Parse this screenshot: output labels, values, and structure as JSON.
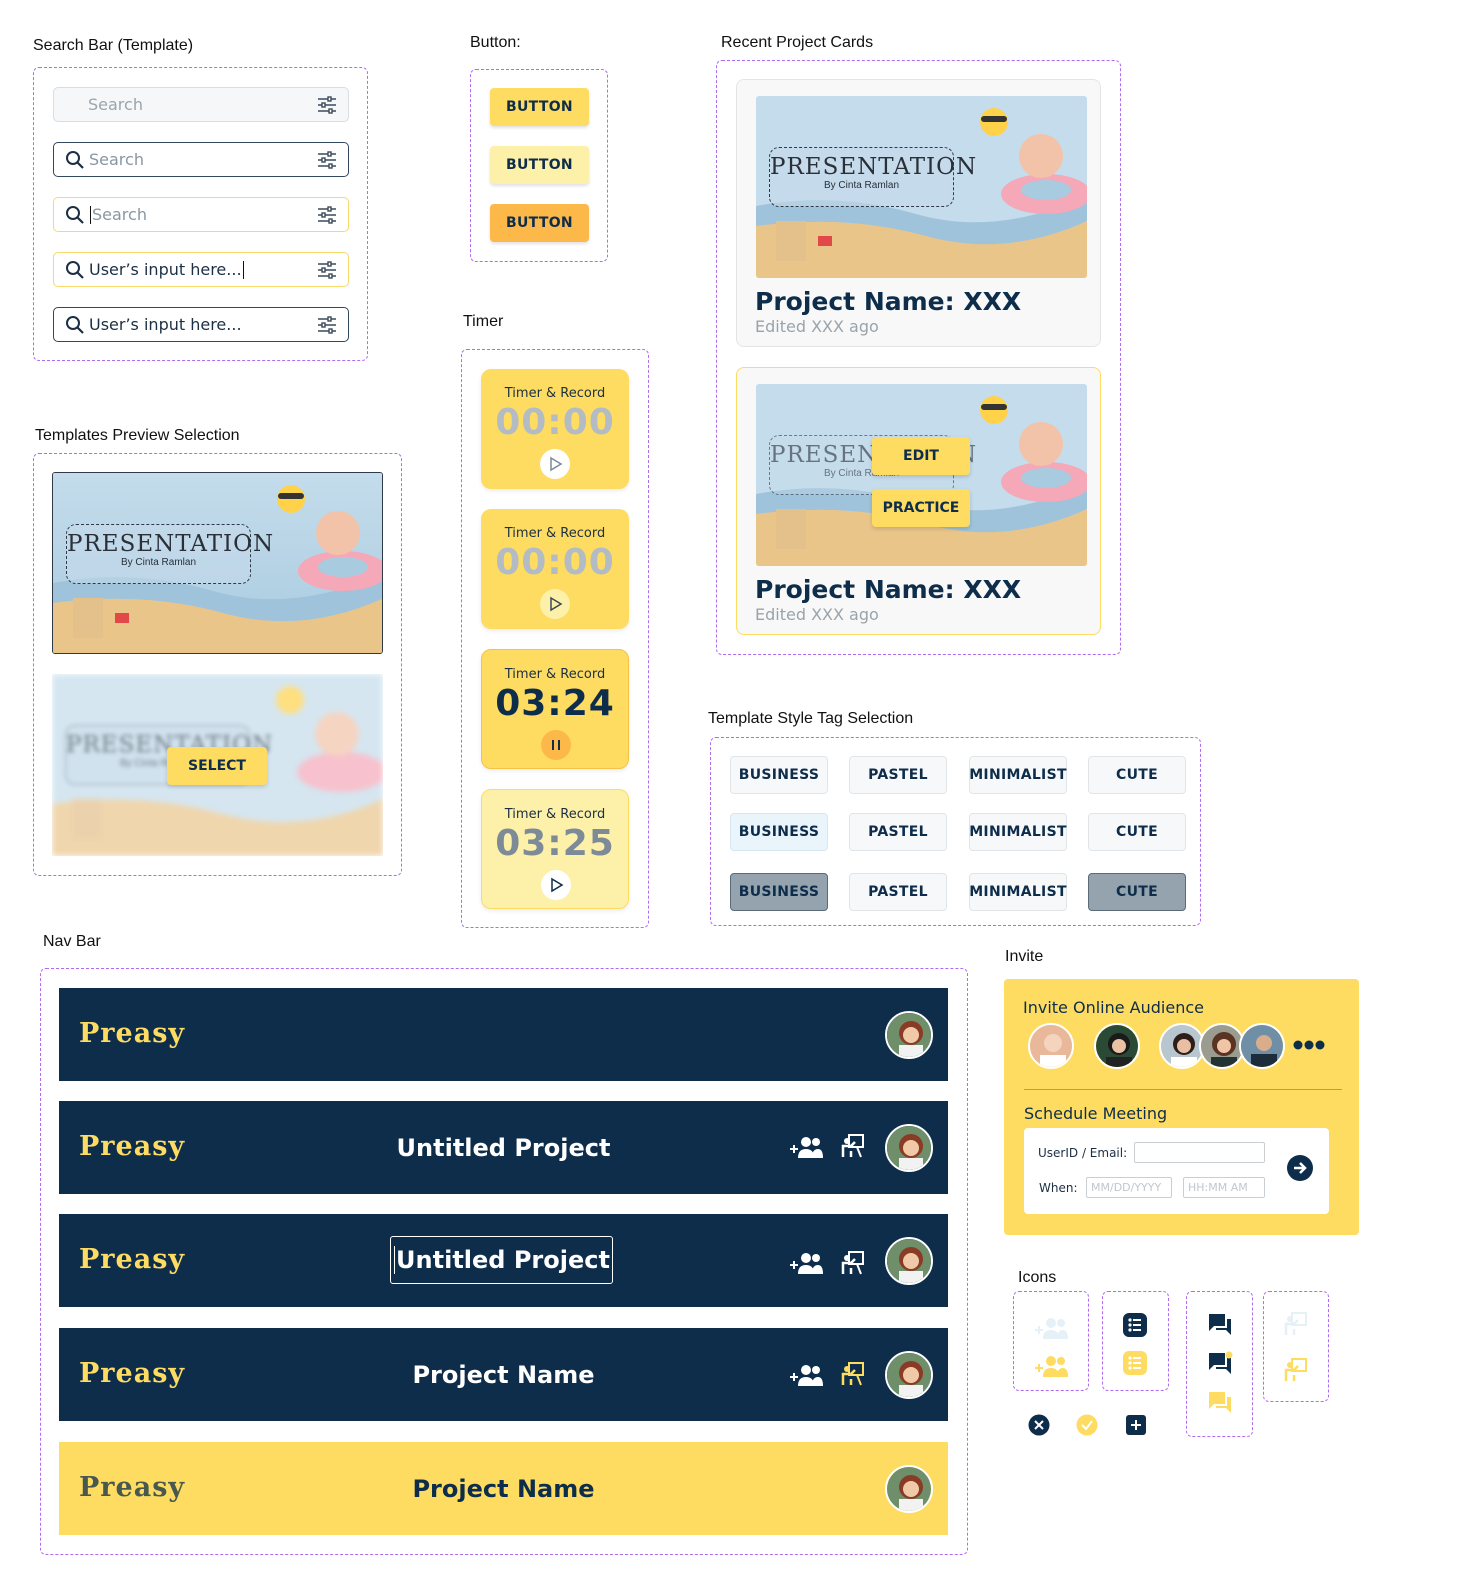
{
  "sections": {
    "search_bar": "Search Bar (Template)",
    "button": "Button:",
    "recent_cards": "Recent Project Cards",
    "timer": "Timer",
    "templates_preview": "Templates Preview Selection",
    "style_tags": "Template Style Tag Selection",
    "nav_bar": "Nav Bar",
    "invite": "Invite",
    "icons": "Icons"
  },
  "search": {
    "placeholder": "Search",
    "input_value": "User’s input here...",
    "bars": [
      "Search",
      "Search",
      "Search",
      "User’s input here...",
      "User’s input here..."
    ]
  },
  "buttons": {
    "labels": [
      "BUTTON",
      "BUTTON",
      "BUTTON"
    ],
    "colors": [
      "#fddc61",
      "#fdf0a8",
      "#fdb84a"
    ]
  },
  "timer": {
    "items": [
      {
        "label": "Timer & Record",
        "value": "00:00",
        "control": "play-icon"
      },
      {
        "label": "Timer & Record",
        "value": "00:00",
        "control": "play-icon"
      },
      {
        "label": "Timer & Record",
        "value": "03:24",
        "control": "pause-icon"
      },
      {
        "label": "Timer & Record",
        "value": "03:25",
        "control": "play-icon"
      }
    ]
  },
  "slide": {
    "title": "PRESENTATION",
    "author": "By Cinta Ramlan"
  },
  "templates_preview": {
    "select_label": "SELECT"
  },
  "cards": [
    {
      "name": "Project Name: XXX",
      "edited": "Edited XXX ago"
    },
    {
      "name": "Project Name: XXX",
      "edited": "Edited XXX ago",
      "edit_label": "EDIT",
      "practice_label": "PRACTICE"
    }
  ],
  "tags": {
    "labels": [
      "BUSINESS",
      "PASTEL",
      "MINIMALIST",
      "CUTE"
    ]
  },
  "nav": {
    "logo": "Preasy",
    "bars": [
      {
        "title": ""
      },
      {
        "title": "Untitled Project"
      },
      {
        "title": "Untitled Project"
      },
      {
        "title": "Project Name"
      },
      {
        "title": "Project Name"
      }
    ],
    "colors": {
      "dark": "#0e2d4a",
      "yellow": "#fddc61"
    }
  },
  "invite": {
    "online_title": "Invite Online Audience",
    "schedule_title": "Schedule Meeting",
    "userid_label": "UserID / Email:",
    "when_label": "When:",
    "date_placeholder": "MM/DD/YYYY",
    "time_placeholder": "HH:MM  AM"
  },
  "icons": {
    "names": [
      "add-user-icon",
      "list-icon",
      "chat-icon",
      "presenter-icon",
      "close-circle-icon",
      "check-circle-icon",
      "plus-square-icon"
    ]
  }
}
